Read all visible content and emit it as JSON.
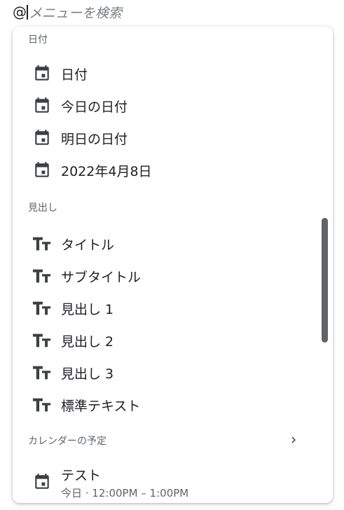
{
  "search": {
    "at": "@",
    "placeholder": "メニューを検索"
  },
  "sections": {
    "date": {
      "header": "日付",
      "items": [
        {
          "label": "日付",
          "icon": "calendar-icon"
        },
        {
          "label": "今日の日付",
          "icon": "calendar-icon"
        },
        {
          "label": "明日の日付",
          "icon": "calendar-icon"
        },
        {
          "label": "2022年4月8日",
          "icon": "calendar-icon"
        }
      ]
    },
    "headings": {
      "header": "見出し",
      "items": [
        {
          "label": "タイトル",
          "icon": "text-style-icon"
        },
        {
          "label": "サブタイトル",
          "icon": "text-style-icon"
        },
        {
          "label": "見出し 1",
          "icon": "text-style-icon"
        },
        {
          "label": "見出し 2",
          "icon": "text-style-icon"
        },
        {
          "label": "見出し 3",
          "icon": "text-style-icon"
        },
        {
          "label": "標準テキスト",
          "icon": "text-style-icon"
        }
      ]
    },
    "calendar": {
      "header": "カレンダーの予定",
      "event": {
        "title": "テスト",
        "subtitle": "今日 · 12:00PM – 1:00PM",
        "icon": "calendar-icon"
      }
    }
  },
  "colors": {
    "icon": "#3c4043",
    "text": "#202124",
    "secondary": "#5f6368",
    "scrollbar": "#5f6368"
  }
}
